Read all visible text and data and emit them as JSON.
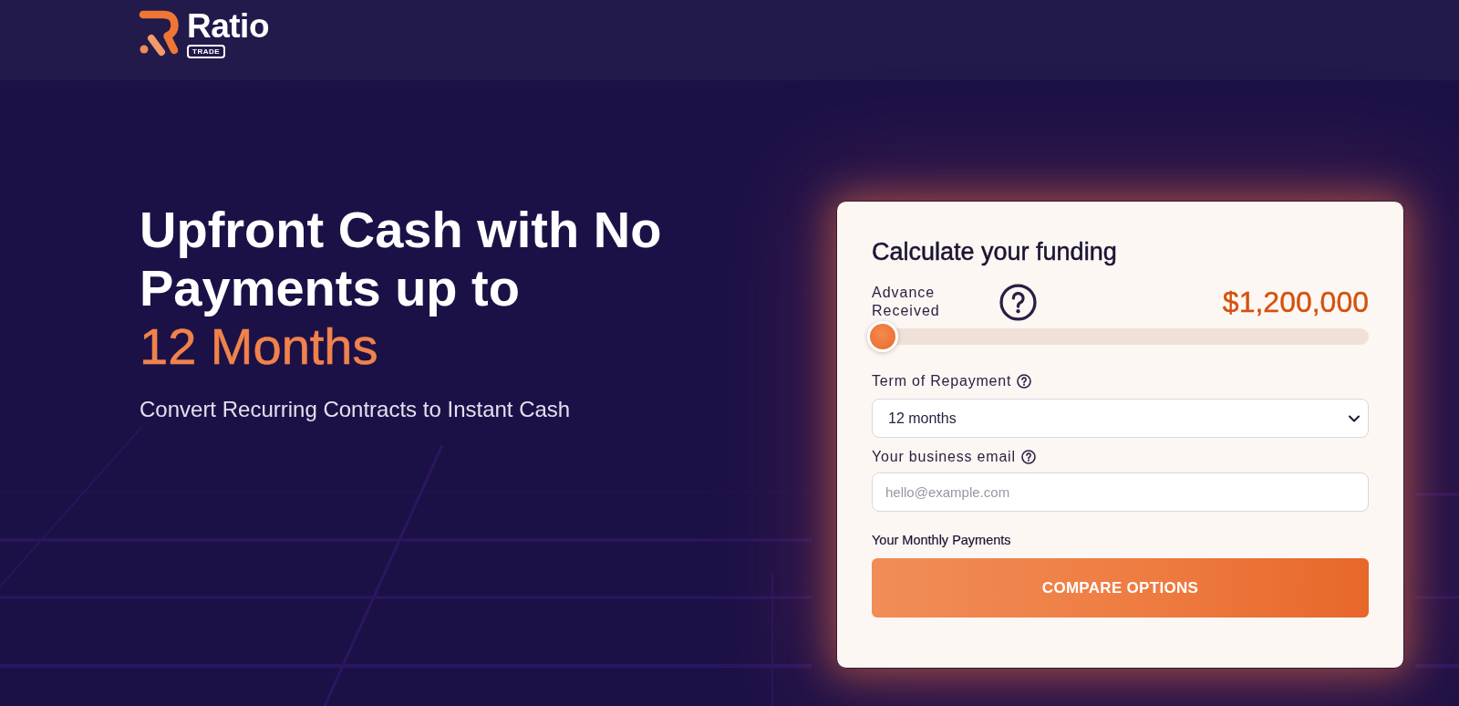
{
  "header": {
    "logo": {
      "wordmark": "Ratio",
      "badge": "TRADE"
    }
  },
  "hero": {
    "headline": "Upfront Cash with No Payments up to",
    "highlight": "12 Months",
    "subtitle": "Convert Recurring Contracts to Instant Cash"
  },
  "calculator": {
    "title": "Calculate your funding",
    "advance": {
      "label": "Advance Received",
      "amount": "$1,200,000",
      "level": 0
    },
    "fields": [
      {
        "kind": "select",
        "label": "Term of Repayment",
        "value": "12 months"
      },
      {
        "kind": "email",
        "label": "Your business email",
        "placeholder": "hello@example.com"
      }
    ],
    "payments_label": "Your Monthly Payments",
    "button": "COMPARE OPTIONS"
  }
}
